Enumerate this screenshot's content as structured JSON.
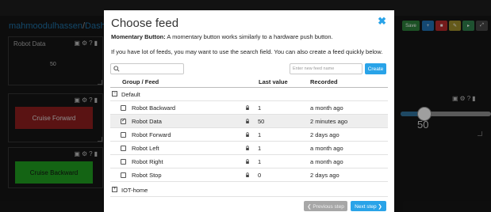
{
  "background": {
    "breadcrumb_user": "mahmoodulhassen",
    "breadcrumb_sep": "/",
    "breadcrumb_page": "Dashbo",
    "toolbar": {
      "save_label": "Save",
      "add_label": "+",
      "delete_label": "■",
      "key_label": "✎",
      "settings_label": "▸",
      "fullscreen_label": "⤢"
    },
    "blocks": [
      {
        "title": "Robot Data",
        "value": "50"
      },
      {
        "button_label": "Cruise Forward",
        "button_color": "#8b1e1e"
      },
      {
        "button_label": "Cruise Backward",
        "button_color": "#1f9a1f"
      }
    ],
    "slider_value": "50",
    "tools_glyphs": "▣⚙?▮"
  },
  "modal": {
    "title": "Choose feed",
    "close_glyph": "✖",
    "description_bold": "Momentary Button:",
    "description_text": " A momentary button works similarly to a hardware push button.",
    "hint": "If you have lot of feeds, you may want to use the search field. You can also create a feed quickly below.",
    "search": {
      "value": "",
      "placeholder": ""
    },
    "new_feed": {
      "value": "",
      "placeholder": "Enter new feed name"
    },
    "create_label": "Create",
    "columns": {
      "group_feed": "Group / Feed",
      "last_value": "Last value",
      "recorded": "Recorded"
    },
    "groups": [
      {
        "name": "Default",
        "toggle": "−",
        "feeds": [
          {
            "name": "Robot Backward",
            "value": "1",
            "recorded": "a month ago",
            "checked": false
          },
          {
            "name": "Robot Data",
            "value": "50",
            "recorded": "2 minutes ago",
            "checked": true
          },
          {
            "name": "Robot Forward",
            "value": "1",
            "recorded": "2 days ago",
            "checked": false
          },
          {
            "name": "Robot Left",
            "value": "1",
            "recorded": "a month ago",
            "checked": false
          },
          {
            "name": "Robot Right",
            "value": "1",
            "recorded": "a month ago",
            "checked": false
          },
          {
            "name": "Robot Stop",
            "value": "0",
            "recorded": "2 days ago",
            "checked": false
          }
        ]
      },
      {
        "name": "IOT-home",
        "toggle": "+",
        "feeds": []
      }
    ],
    "prev_label": "❮ Previous step",
    "next_label": "Next step ❯"
  },
  "colors": {
    "accent": "#29a3e8",
    "disabled": "#a7a7a7",
    "selected_row": "#eeeeee"
  }
}
